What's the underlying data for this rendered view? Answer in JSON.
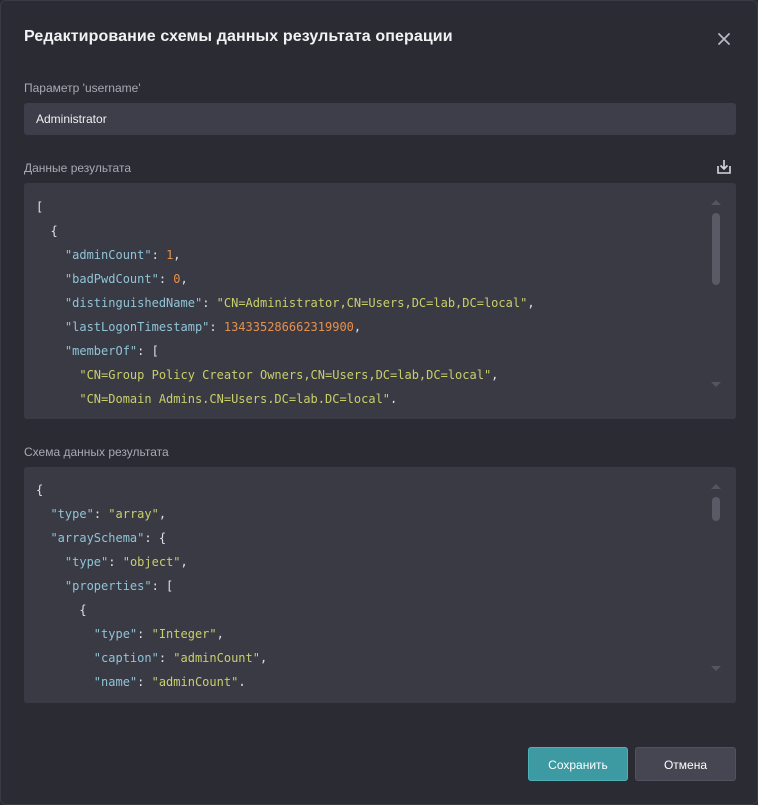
{
  "dialog": {
    "title": "Редактирование схемы данных результата операции",
    "param_label": "Параметр 'username'",
    "param_value": "Administrator",
    "result_label": "Данные результата",
    "schema_label": "Схема данных результата",
    "save_label": "Сохранить",
    "cancel_label": "Отмена"
  },
  "result_code": [
    [
      {
        "t": "p",
        "v": "["
      }
    ],
    [
      {
        "t": "p",
        "v": "  {"
      }
    ],
    [
      {
        "t": "p",
        "v": "    "
      },
      {
        "t": "k",
        "v": "\"adminCount\""
      },
      {
        "t": "p",
        "v": ": "
      },
      {
        "t": "n",
        "v": "1"
      },
      {
        "t": "p",
        "v": ","
      }
    ],
    [
      {
        "t": "p",
        "v": "    "
      },
      {
        "t": "k",
        "v": "\"badPwdCount\""
      },
      {
        "t": "p",
        "v": ": "
      },
      {
        "t": "n",
        "v": "0"
      },
      {
        "t": "p",
        "v": ","
      }
    ],
    [
      {
        "t": "p",
        "v": "    "
      },
      {
        "t": "k",
        "v": "\"distinguishedName\""
      },
      {
        "t": "p",
        "v": ": "
      },
      {
        "t": "s",
        "v": "\"CN=Administrator,CN=Users,DC=lab,DC=local\""
      },
      {
        "t": "p",
        "v": ","
      }
    ],
    [
      {
        "t": "p",
        "v": "    "
      },
      {
        "t": "k",
        "v": "\"lastLogonTimestamp\""
      },
      {
        "t": "p",
        "v": ": "
      },
      {
        "t": "n",
        "v": "134335286662319900"
      },
      {
        "t": "p",
        "v": ","
      }
    ],
    [
      {
        "t": "p",
        "v": "    "
      },
      {
        "t": "k",
        "v": "\"memberOf\""
      },
      {
        "t": "p",
        "v": ": ["
      }
    ],
    [
      {
        "t": "p",
        "v": "      "
      },
      {
        "t": "s",
        "v": "\"CN=Group Policy Creator Owners,CN=Users,DC=lab,DC=local\""
      },
      {
        "t": "p",
        "v": ","
      }
    ],
    [
      {
        "t": "p",
        "v": "      "
      },
      {
        "t": "s",
        "v": "\"CN=Domain Admins,CN=Users,DC=lab,DC=local\""
      },
      {
        "t": "p",
        "v": ","
      }
    ]
  ],
  "schema_code": [
    [
      {
        "t": "p",
        "v": "{"
      }
    ],
    [
      {
        "t": "p",
        "v": "  "
      },
      {
        "t": "k",
        "v": "\"type\""
      },
      {
        "t": "p",
        "v": ": "
      },
      {
        "t": "s",
        "v": "\"array\""
      },
      {
        "t": "p",
        "v": ","
      }
    ],
    [
      {
        "t": "p",
        "v": "  "
      },
      {
        "t": "k",
        "v": "\"arraySchema\""
      },
      {
        "t": "p",
        "v": ": {"
      }
    ],
    [
      {
        "t": "p",
        "v": "    "
      },
      {
        "t": "k",
        "v": "\"type\""
      },
      {
        "t": "p",
        "v": ": "
      },
      {
        "t": "s",
        "v": "\"object\""
      },
      {
        "t": "p",
        "v": ","
      }
    ],
    [
      {
        "t": "p",
        "v": "    "
      },
      {
        "t": "k",
        "v": "\"properties\""
      },
      {
        "t": "p",
        "v": ": ["
      }
    ],
    [
      {
        "t": "p",
        "v": "      {"
      }
    ],
    [
      {
        "t": "p",
        "v": "        "
      },
      {
        "t": "k",
        "v": "\"type\""
      },
      {
        "t": "p",
        "v": ": "
      },
      {
        "t": "s",
        "v": "\"Integer\""
      },
      {
        "t": "p",
        "v": ","
      }
    ],
    [
      {
        "t": "p",
        "v": "        "
      },
      {
        "t": "k",
        "v": "\"caption\""
      },
      {
        "t": "p",
        "v": ": "
      },
      {
        "t": "s",
        "v": "\"adminCount\""
      },
      {
        "t": "p",
        "v": ","
      }
    ],
    [
      {
        "t": "p",
        "v": "        "
      },
      {
        "t": "k",
        "v": "\"name\""
      },
      {
        "t": "p",
        "v": ": "
      },
      {
        "t": "s",
        "v": "\"adminCount\""
      },
      {
        "t": "p",
        "v": ","
      }
    ]
  ]
}
